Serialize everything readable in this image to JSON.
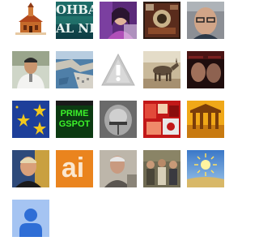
{
  "avatars": [
    {
      "name": "church-avatar"
    },
    {
      "name": "ohba-text-avatar",
      "text_line1": "OHBA",
      "text_line2": "AL NE"
    },
    {
      "name": "purple-portrait-avatar"
    },
    {
      "name": "dark-collage-avatar"
    },
    {
      "name": "man-glasses-avatar"
    },
    {
      "name": "man-white-shirt-avatar"
    },
    {
      "name": "harbor-aerial-avatar"
    },
    {
      "name": "warning-placeholder-avatar",
      "icon": "warning-icon"
    },
    {
      "name": "donkey-avatar"
    },
    {
      "name": "dark-faces-avatar"
    },
    {
      "name": "eu-stars-avatar"
    },
    {
      "name": "green-blogspot-avatar",
      "text_line1": "PRIME",
      "text_line2": "GSPOT"
    },
    {
      "name": "metal-helmet-avatar"
    },
    {
      "name": "red-collage-avatar"
    },
    {
      "name": "temple-avatar"
    },
    {
      "name": "man-portrait-avatar"
    },
    {
      "name": "orange-ai-avatar",
      "text": "ai"
    },
    {
      "name": "old-man-avatar"
    },
    {
      "name": "group-photo-avatar"
    },
    {
      "name": "sun-landscape-avatar"
    },
    {
      "name": "default-user-avatar",
      "icon": "person-icon"
    }
  ]
}
